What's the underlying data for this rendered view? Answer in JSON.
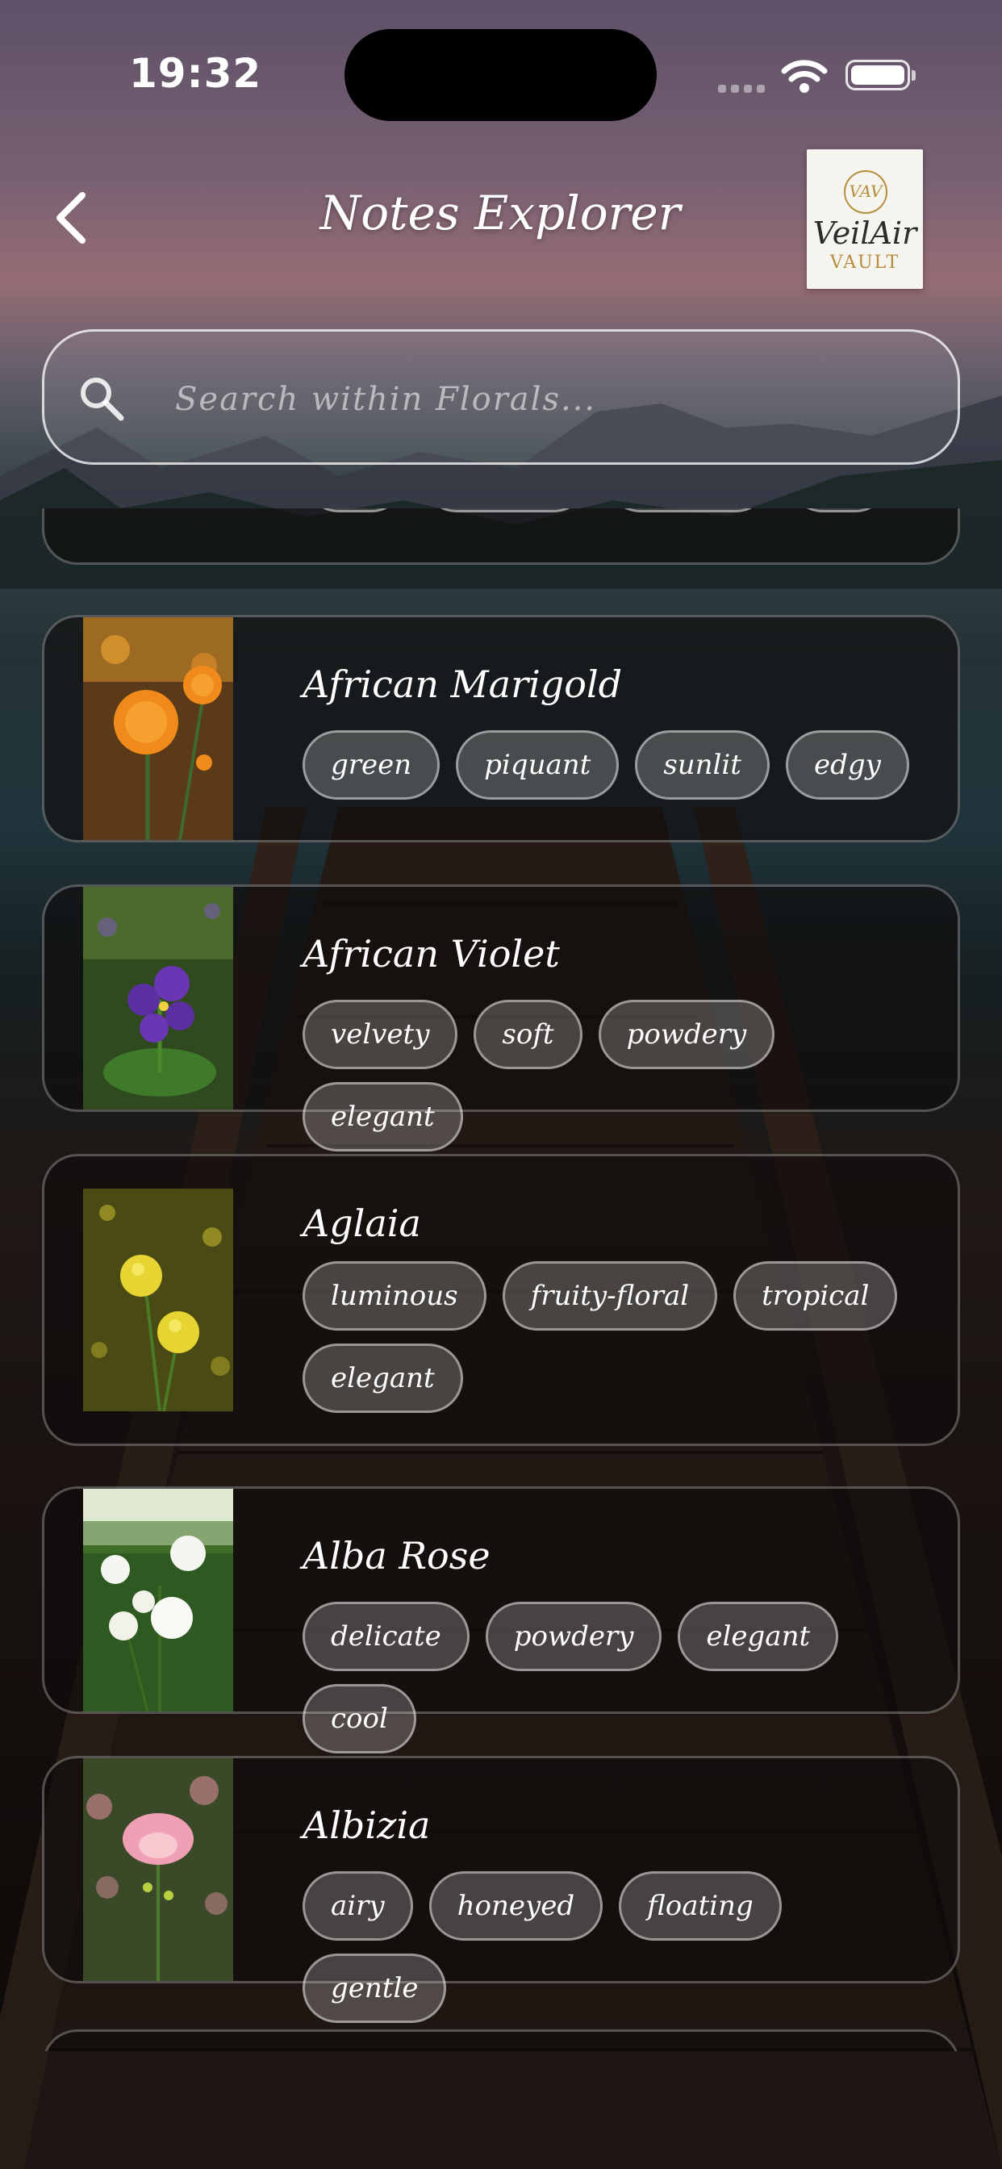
{
  "status_bar": {
    "time": "19:32"
  },
  "header": {
    "title": "Notes Explorer"
  },
  "logo": {
    "monogram": "VAV",
    "name": "VeilAir",
    "sub": "VAULT"
  },
  "search": {
    "placeholder": "Search within Florals..."
  },
  "items": [
    {
      "name": "African Marigold",
      "tags": [
        "green",
        "piquant",
        "sunlit",
        "edgy"
      ]
    },
    {
      "name": "African Violet",
      "tags": [
        "velvety",
        "soft",
        "powdery",
        "elegant"
      ]
    },
    {
      "name": "Aglaia",
      "tags": [
        "luminous",
        "fruity-floral",
        "tropical",
        "elegant"
      ]
    },
    {
      "name": "Alba Rose",
      "tags": [
        "delicate",
        "powdery",
        "elegant",
        "cool"
      ]
    },
    {
      "name": "Albizia",
      "tags": [
        "airy",
        "honeyed",
        "floating",
        "gentle"
      ]
    }
  ],
  "colors": {
    "accent_gold": "#b48e3c",
    "card_bg": "rgba(15,12,12,0.62)"
  }
}
